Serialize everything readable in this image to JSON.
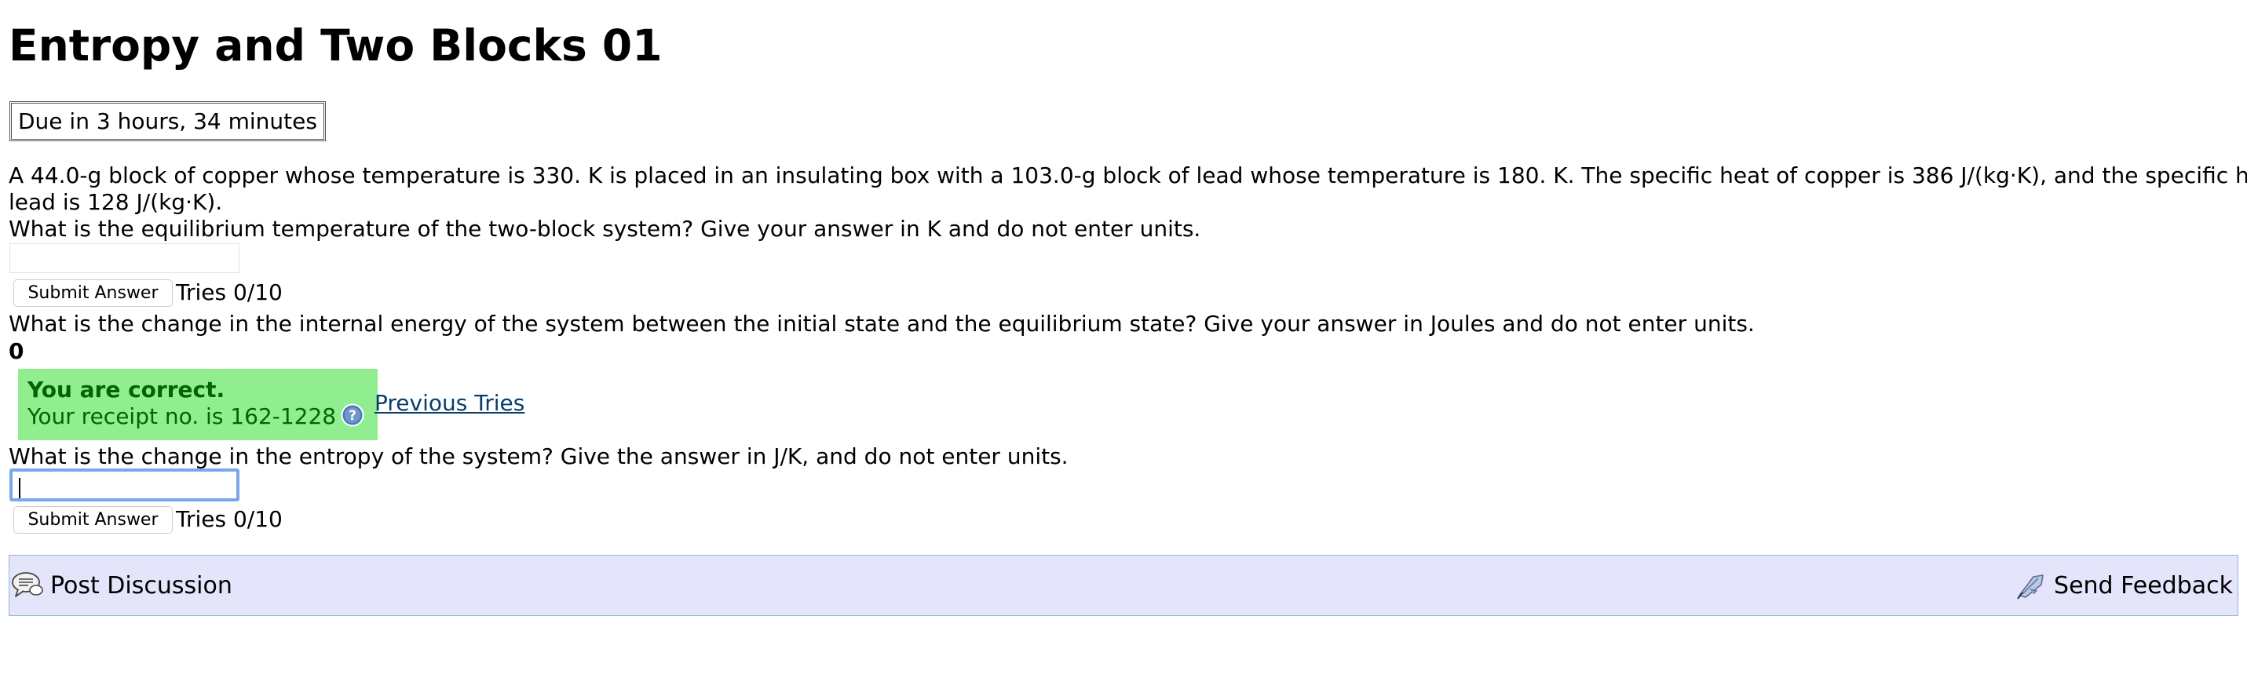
{
  "page": {
    "title": "Entropy and Two Blocks 01",
    "due": "Due in 3 hours, 34 minutes"
  },
  "problem": {
    "statement_line1": "A 44.0-g block of copper whose temperature is 330. K is placed in an insulating box with a 103.0-g block of lead whose temperature is 180. K. The specific heat of copper is 386 J/(kg·K), and the specific heat of",
    "statement_line2": "lead is 128 J/(kg·K)."
  },
  "parts": [
    {
      "question": "What is the equilibrium temperature of the two-block system? Give your answer in K and do not enter units.",
      "input_value": "",
      "submit_label": "Submit Answer",
      "tries": "Tries 0/10"
    },
    {
      "question": "What is the change in the internal energy of the system between the initial state and the equilibrium state? Give your answer in Joules and do not enter units.",
      "submitted_answer": "0",
      "feedback_title": "You are correct.",
      "receipt": "Your receipt no. is 162-1228",
      "previous_tries": "Previous Tries"
    },
    {
      "question": "What is the change in the entropy of the system? Give the answer in J/K, and do not enter units.",
      "input_value": "",
      "submit_label": "Submit Answer",
      "tries": "Tries 0/10"
    }
  ],
  "footer": {
    "post_discussion": "Post Discussion",
    "send_feedback": "Send Feedback",
    "post_icon": "discussion-bubbles-icon",
    "feedback_icon": "feedback-quill-icon"
  },
  "colors": {
    "correct_bg": "#90ee90",
    "correct_text": "#006400",
    "link": "#0a3d6b",
    "bar_bg": "#e4e4fa",
    "bar_border": "#8fb4e3",
    "focus_ring": "#7aa7e6"
  }
}
